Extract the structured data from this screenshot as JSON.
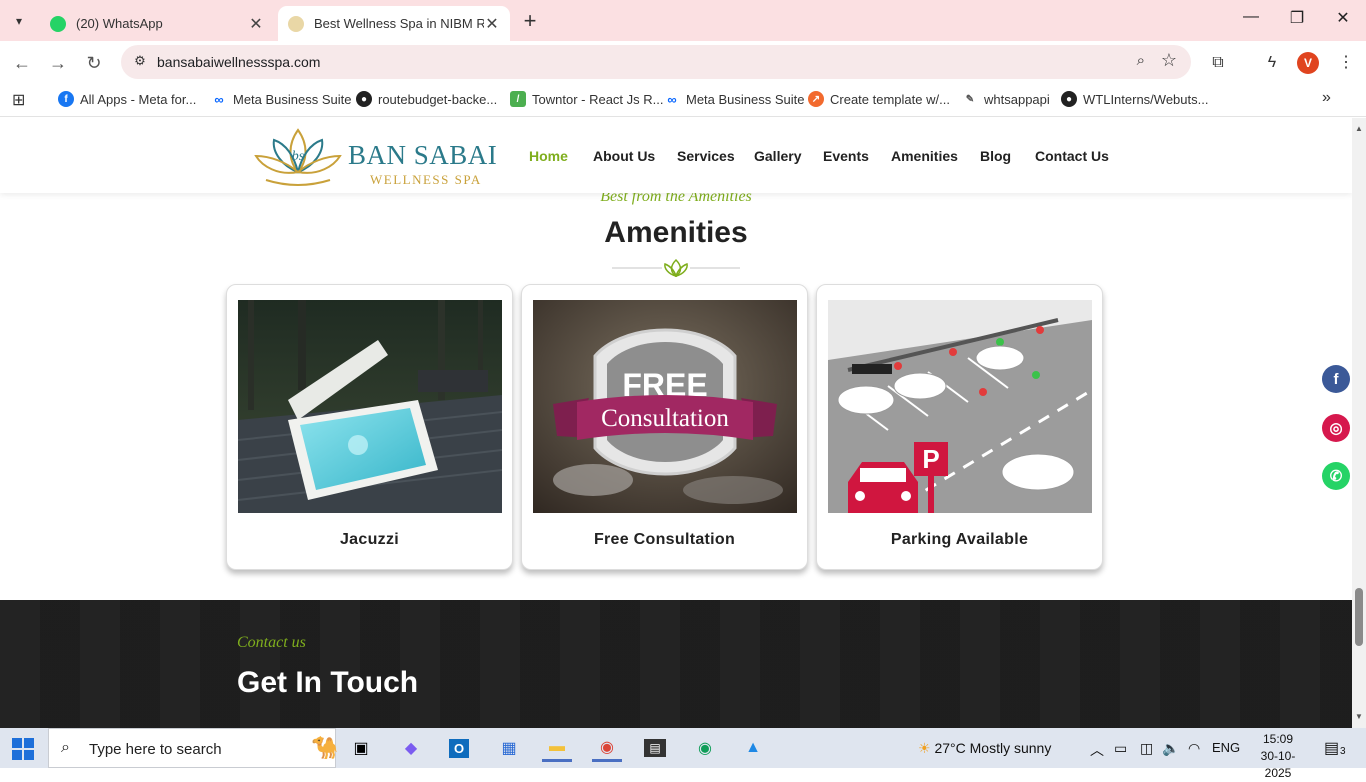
{
  "browser": {
    "tabs": [
      {
        "title": "(20) WhatsApp"
      },
      {
        "title": "Best Wellness Spa in NIBM Road"
      }
    ],
    "url": "bansabaiwellnessspa.com",
    "profile_initial": "V",
    "bookmarks": [
      {
        "label": "All Apps - Meta for..."
      },
      {
        "label": "Meta Business Suite"
      },
      {
        "label": "routebudget-backe..."
      },
      {
        "label": "Towntor - React Js R..."
      },
      {
        "label": "Meta Business Suite"
      },
      {
        "label": "Create template w/..."
      },
      {
        "label": "whtsappapi"
      },
      {
        "label": "WTLInterns/Webuts..."
      }
    ]
  },
  "site": {
    "logo": {
      "brand": "BAN SABAI",
      "sub": "WELLNESS SPA",
      "mark": "bs"
    },
    "nav": [
      "Home",
      "About Us",
      "Services",
      "Gallery",
      "Events",
      "Amenities",
      "Blog",
      "Contact Us"
    ],
    "amenities": {
      "kicker": "Best from the Amenities",
      "title": "Amenities",
      "cards": [
        {
          "caption": "Jacuzzi"
        },
        {
          "caption": "Free Consultation",
          "badge_top": "FREE",
          "badge_ribbon": "Consultation"
        },
        {
          "caption": "Parking Available",
          "sign": "P"
        }
      ]
    },
    "contact": {
      "kicker": "Contact us",
      "title": "Get In Touch"
    },
    "social": [
      "f",
      "ig",
      "wa"
    ]
  },
  "taskbar": {
    "search_placeholder": "Type here to search",
    "weather": "27°C  Mostly sunny",
    "language": "ENG",
    "time": "15:09",
    "date": "30-10-2025",
    "notifications": "3"
  },
  "colors": {
    "accent_green": "#7fae1d",
    "brand_teal": "#2b7a8a",
    "tab_bar": "#fbe0e2"
  }
}
